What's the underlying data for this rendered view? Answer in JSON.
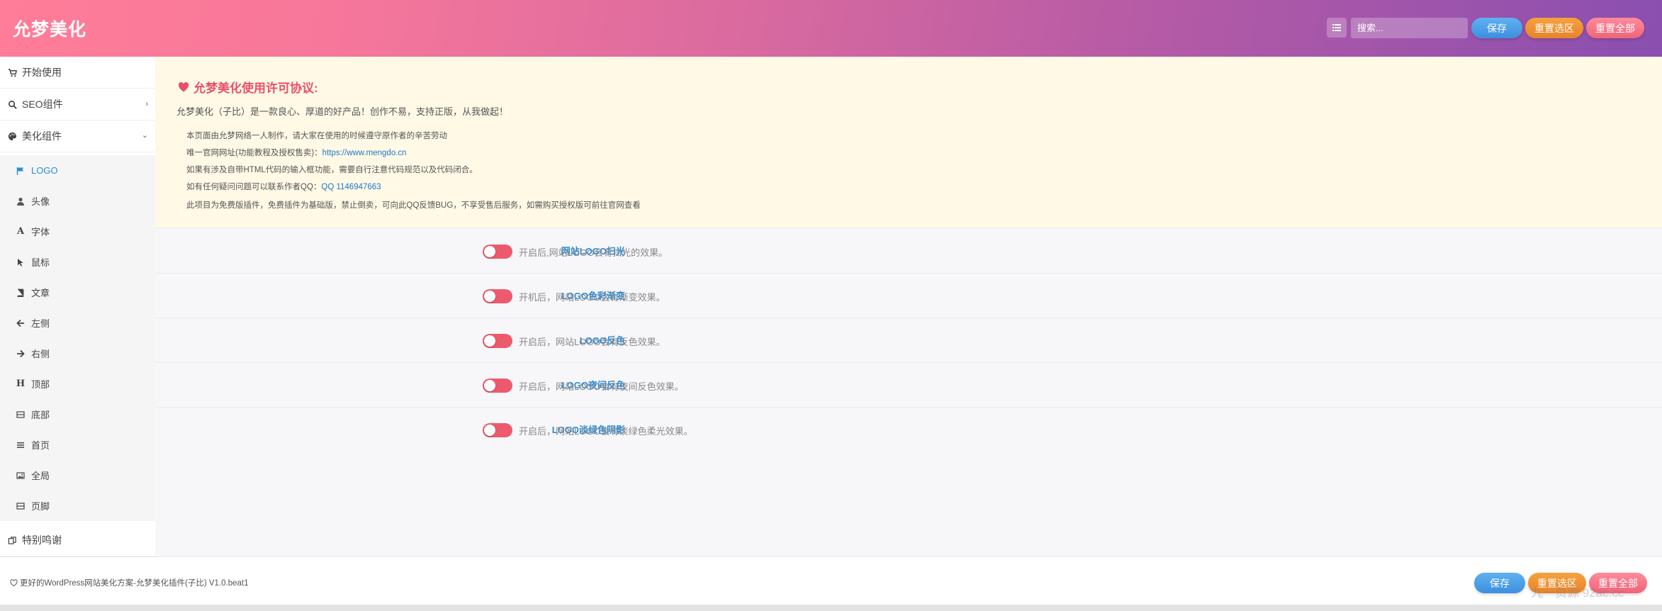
{
  "header": {
    "brand": "允梦美化",
    "search_placeholder": "搜索...",
    "save_label": "保存",
    "reset_section_label": "重置选区",
    "reset_all_label": "重置全部",
    "gradient_start": "#ff7d98",
    "gradient_end": "#8a4fb0"
  },
  "sidebar": {
    "items": [
      {
        "label": "开始使用",
        "icon": "cart-icon"
      },
      {
        "label": "SEO组件",
        "icon": "search-icon"
      },
      {
        "label": "美化组件",
        "icon": "palette-icon"
      }
    ],
    "sub_items": [
      {
        "label": "LOGO",
        "icon": "flag-icon"
      },
      {
        "label": "头像",
        "icon": "user-icon"
      },
      {
        "label": "字体",
        "icon": "font-icon"
      },
      {
        "label": "鼠标",
        "icon": "cursor-icon"
      },
      {
        "label": "文章",
        "icon": "book-icon"
      },
      {
        "label": "左侧",
        "icon": "arrow-left-icon"
      },
      {
        "label": "右侧",
        "icon": "arrow-right-icon"
      },
      {
        "label": "顶部",
        "icon": "header-icon"
      },
      {
        "label": "底部",
        "icon": "window-icon"
      },
      {
        "label": "首页",
        "icon": "list-icon"
      },
      {
        "label": "全局",
        "icon": "image-icon"
      },
      {
        "label": "页脚",
        "icon": "window-icon"
      }
    ],
    "bottom_item": {
      "label": "特别鸣谢",
      "icon": "copy-icon"
    },
    "active_color": "#2a8bd6"
  },
  "notice": {
    "title": "允梦美化使用许可协议:",
    "intro": "允梦美化（子比）是一款良心、厚道的好产品！创作不易，支持正版，从我做起！",
    "line1": "本页面由允梦网络一人制作，请大家在使用的时候遵守原作者的辛苦劳动",
    "line2_prefix": "唯一官网网址(功能教程及授权售卖)：",
    "line2_link": "https://www.mengdo.cn",
    "line3": "如果有涉及自带HTML代码的输入框功能，需要自行注意代码规范以及代码闭合。",
    "line4_prefix": "如有任何疑问问题可以联系作者QQ：",
    "line4_link": "QQ 1146947663",
    "line5": "此项目为免费版插件，免费插件为基础版，禁止倒卖，可向此QQ反馈BUG，不享受售后服务，如需购买授权版可前往官网查看",
    "title_color": "#e8506a"
  },
  "options": [
    {
      "label": "网站LOGO扫光",
      "description": "开启后,网站LOGO会有扫光的效果。",
      "enabled": false
    },
    {
      "label": "LOGO色彩渐变",
      "description": "开机后，网站LOGO会有渐变效果。",
      "enabled": false
    },
    {
      "label": "LOGO反色",
      "description": "开启后，网站LOGO会有反色效果。",
      "enabled": false
    },
    {
      "label": "LOGO夜间反色",
      "description": "开启后，网站LOGO会有夜间反色效果。",
      "enabled": false
    },
    {
      "label": "LOGO淡绿色阴影",
      "description": "开启后，网站LOGO会有淡绿色柔光效果。",
      "enabled": false
    }
  ],
  "footer": {
    "text": "更好的WordPress网站美化方案-允梦美化插件(子比) V1.0.beat1",
    "save_label": "保存",
    "reset_section_label": "重置选区",
    "reset_all_label": "重置全部",
    "watermark": "九一资源 92ac.cc"
  }
}
